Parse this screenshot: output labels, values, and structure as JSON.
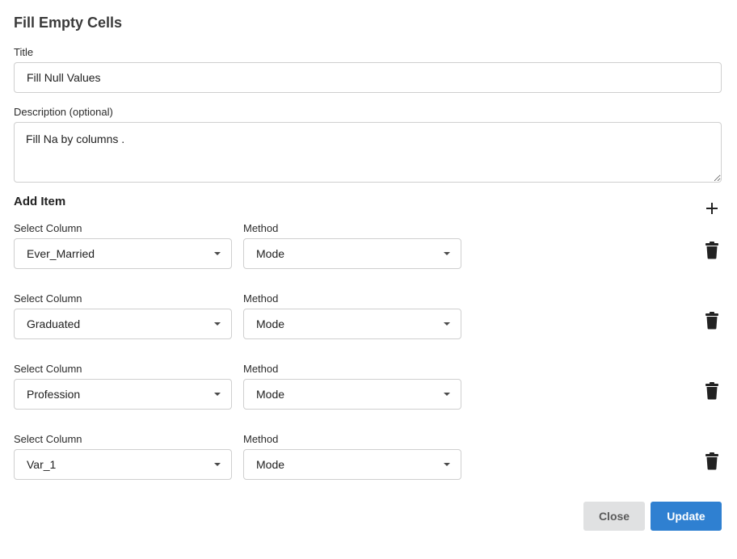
{
  "dialog": {
    "title": "Fill Empty Cells"
  },
  "form": {
    "title_label": "Title",
    "title_value": "Fill Null Values",
    "description_label": "Description (optional)",
    "description_value": "Fill Na by columns ."
  },
  "items_section": {
    "title": "Add Item",
    "add_icon": "plus-icon",
    "delete_icon": "trash-icon",
    "column_label": "Select Column",
    "method_label": "Method",
    "rows": [
      {
        "column": "Ever_Married",
        "method": "Mode"
      },
      {
        "column": "Graduated",
        "method": "Mode"
      },
      {
        "column": "Profession",
        "method": "Mode"
      },
      {
        "column": "Var_1",
        "method": "Mode"
      }
    ]
  },
  "actions": {
    "close_label": "Close",
    "update_label": "Update"
  },
  "colors": {
    "primary": "#2f80d1",
    "secondary": "#e0e1e2"
  }
}
